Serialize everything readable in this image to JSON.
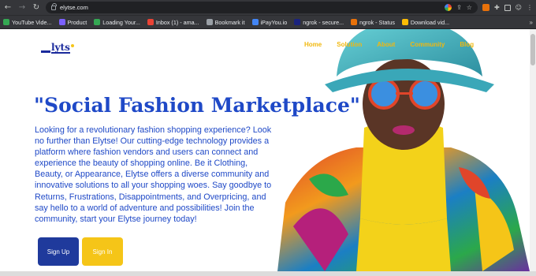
{
  "browser": {
    "url": "elytse.com",
    "nav": {
      "back": "←",
      "forward": "→",
      "reload": "↻"
    },
    "bookmarks": [
      {
        "label": "YouTube Vide...",
        "color": "#34a853"
      },
      {
        "label": "Product",
        "color": "#7b61ff"
      },
      {
        "label": "Loading Your...",
        "color": "#34a853"
      },
      {
        "label": "Inbox (1) - ama...",
        "color": "#ea4335"
      },
      {
        "label": "Bookmark it",
        "color": "#9aa0a6"
      },
      {
        "label": "iPayYou.io",
        "color": "#4285f4"
      },
      {
        "label": "ngrok - secure...",
        "color": "#1a237e"
      },
      {
        "label": "ngrok - Status",
        "color": "#e8710a"
      },
      {
        "label": "Download vid...",
        "color": "#fbbc05"
      }
    ],
    "more": "»"
  },
  "site": {
    "logo_text": "lyts",
    "nav": [
      "Home",
      "Solution",
      "About",
      "Community",
      "Blog"
    ],
    "headline": "\"Social Fashion Marketplace\"",
    "description": "Looking for a revolutionary fashion shopping experience? Look no further than Elytse! Our cutting-edge technology provides a platform where fashion vendors and users can connect and experience the beauty of shopping online. Be it Clothing, Beauty, or Appearance, Elytse offers a diverse community and innovative solutions to all your shopping woes. Say goodbye to Returns, Frustrations, Disappointments, and Overpricing, and say hello to a world of adventure and possibilities! Join the community, start your Elytse journey today!",
    "buttons": {
      "signup": "Sign Up",
      "signin": "Sign In"
    },
    "colors": {
      "primary": "#1f49c7",
      "accent": "#f5c518",
      "button_dark": "#1f3a9c"
    }
  }
}
